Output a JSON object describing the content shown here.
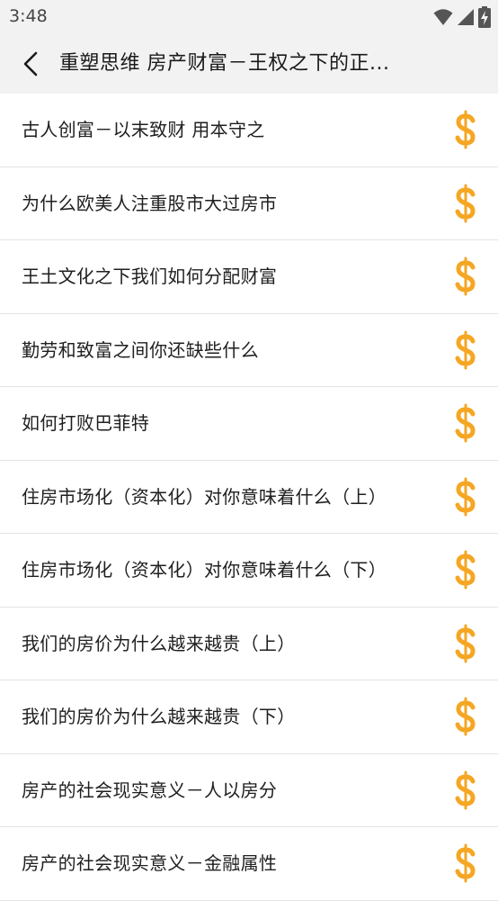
{
  "status_bar": {
    "time": "3:48"
  },
  "header": {
    "title": "重塑思维 房产财富－王权之下的正...",
    "back_icon": "chevron-left-icon"
  },
  "colors": {
    "accent": "#f5a623",
    "header_bg": "#f2f2f2",
    "divider": "#e4e4e4"
  },
  "list": {
    "item_icon": "dollar-icon",
    "items": [
      {
        "title": "古人创富－以末致财 用本守之"
      },
      {
        "title": "为什么欧美人注重股市大过房市"
      },
      {
        "title": "王土文化之下我们如何分配财富"
      },
      {
        "title": "勤劳和致富之间你还缺些什么"
      },
      {
        "title": "如何打败巴菲特"
      },
      {
        "title": "住房市场化（资本化）对你意味着什么（上）"
      },
      {
        "title": "住房市场化（资本化）对你意味着什么（下）"
      },
      {
        "title": "我们的房价为什么越来越贵（上）"
      },
      {
        "title": "我们的房价为什么越来越贵（下）"
      },
      {
        "title": "房产的社会现实意义－人以房分"
      },
      {
        "title": "房产的社会现实意义－金融属性"
      }
    ]
  }
}
